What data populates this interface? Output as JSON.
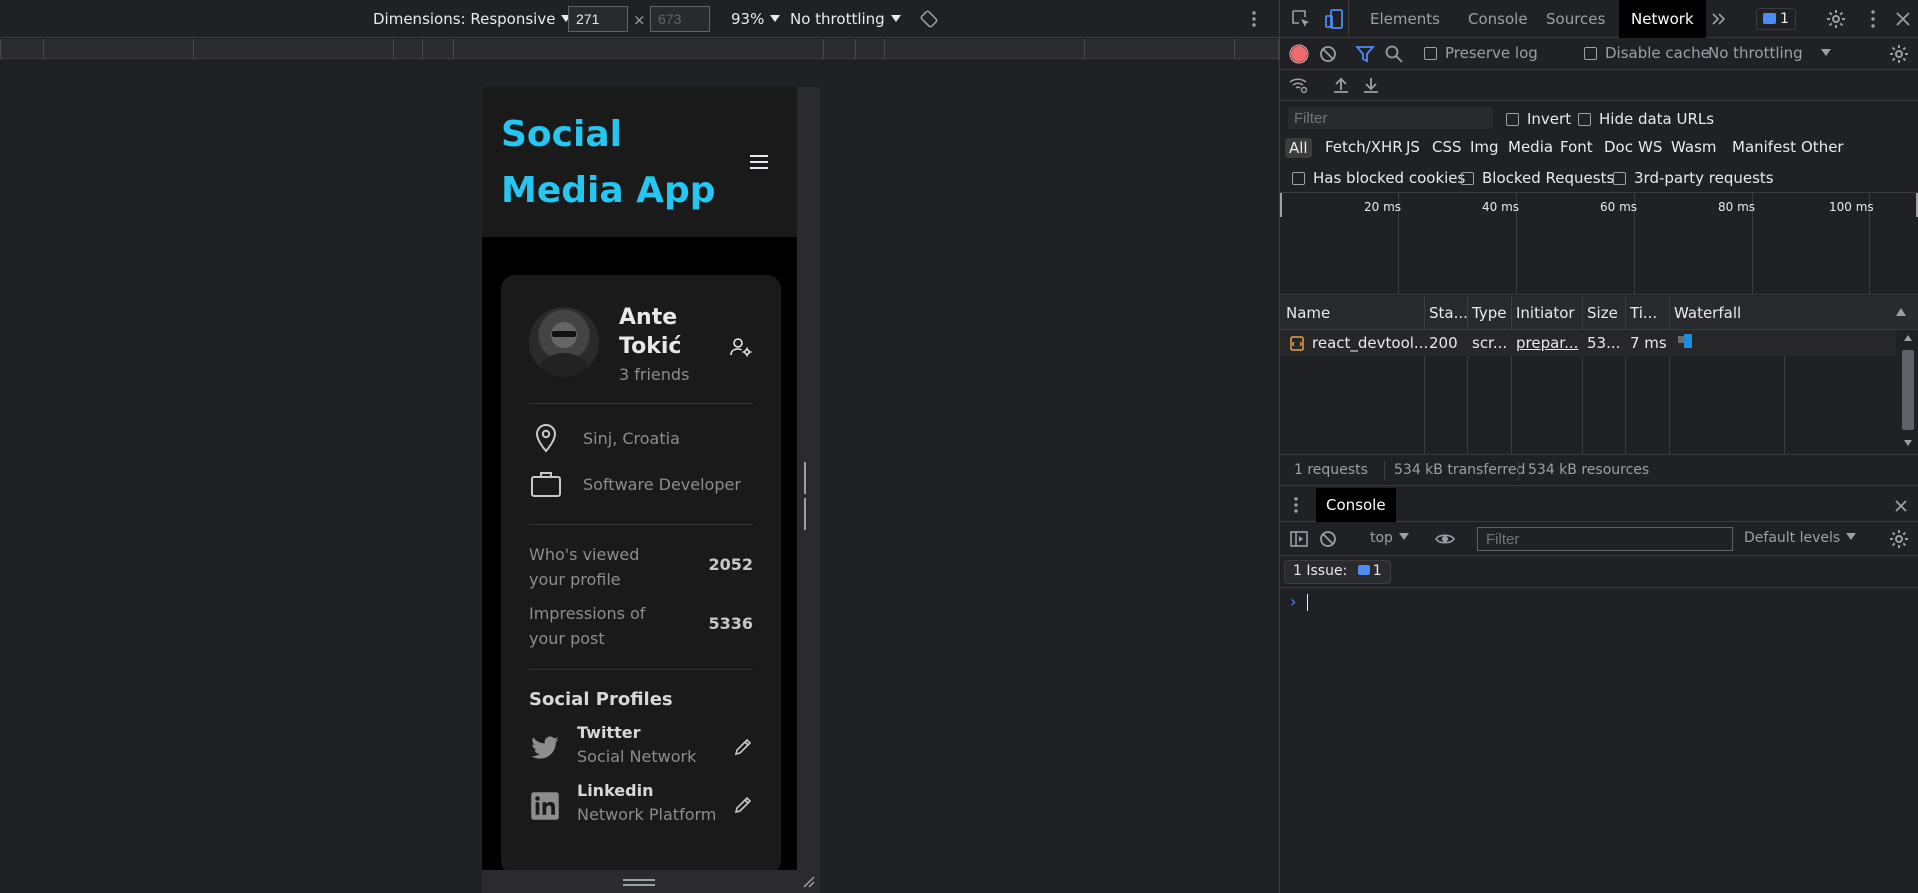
{
  "emulator": {
    "dimensions_label": "Dimensions: Responsive",
    "width_value": "271",
    "height_value": "673",
    "times": "×",
    "zoom": "93%",
    "throttling": "No throttling"
  },
  "app": {
    "title": "Social Media App",
    "profile": {
      "name": "Ante Tokić",
      "friends": "3 friends"
    },
    "info": [
      {
        "icon": "location-pin-icon",
        "label": "Sinj, Croatia"
      },
      {
        "icon": "briefcase-icon",
        "label": "Software Developer"
      }
    ],
    "stats": [
      {
        "label": "Who's viewed your profile",
        "value": "2052"
      },
      {
        "label": "Impressions of your post",
        "value": "5336"
      }
    ],
    "social_title": "Social Profiles",
    "socials": [
      {
        "icon": "twitter-icon",
        "name": "Twitter",
        "desc": "Social Network"
      },
      {
        "icon": "linkedin-icon",
        "name": "Linkedin",
        "desc": "Network Platform"
      }
    ]
  },
  "devtools": {
    "tabs": [
      "Elements",
      "Console",
      "Sources",
      "Network"
    ],
    "active_tab": "Network",
    "issues_badge": "1",
    "network": {
      "preserve_log": "Preserve log",
      "disable_cache": "Disable cache",
      "throttling": "No throttling",
      "filter_placeholder": "Filter",
      "invert": "Invert",
      "hide_data_urls": "Hide data URLs",
      "types": [
        "All",
        "Fetch/XHR",
        "JS",
        "CSS",
        "Img",
        "Media",
        "Font",
        "Doc",
        "WS",
        "Wasm",
        "Manifest",
        "Other"
      ],
      "has_blocked_cookies": "Has blocked cookies",
      "blocked_requests": "Blocked Requests",
      "third_party": "3rd-party requests",
      "timeline_ticks": [
        "20 ms",
        "40 ms",
        "60 ms",
        "80 ms",
        "100 ms"
      ],
      "columns": [
        "Name",
        "Sta...",
        "Type",
        "Initiator",
        "Size",
        "Ti...",
        "Waterfall"
      ],
      "request": {
        "name": "react_devtool...",
        "status": "200",
        "type": "scr...",
        "initiator": "prepar...",
        "size": "53...",
        "time": "7 ms"
      },
      "summary": [
        "1 requests",
        "534 kB transferred",
        "534 kB resources"
      ]
    },
    "console": {
      "tab": "Console",
      "context": "top",
      "filter_placeholder": "Filter",
      "levels": "Default levels",
      "issues_label": "1 Issue:",
      "issues_count": "1",
      "prompt": "›"
    }
  }
}
